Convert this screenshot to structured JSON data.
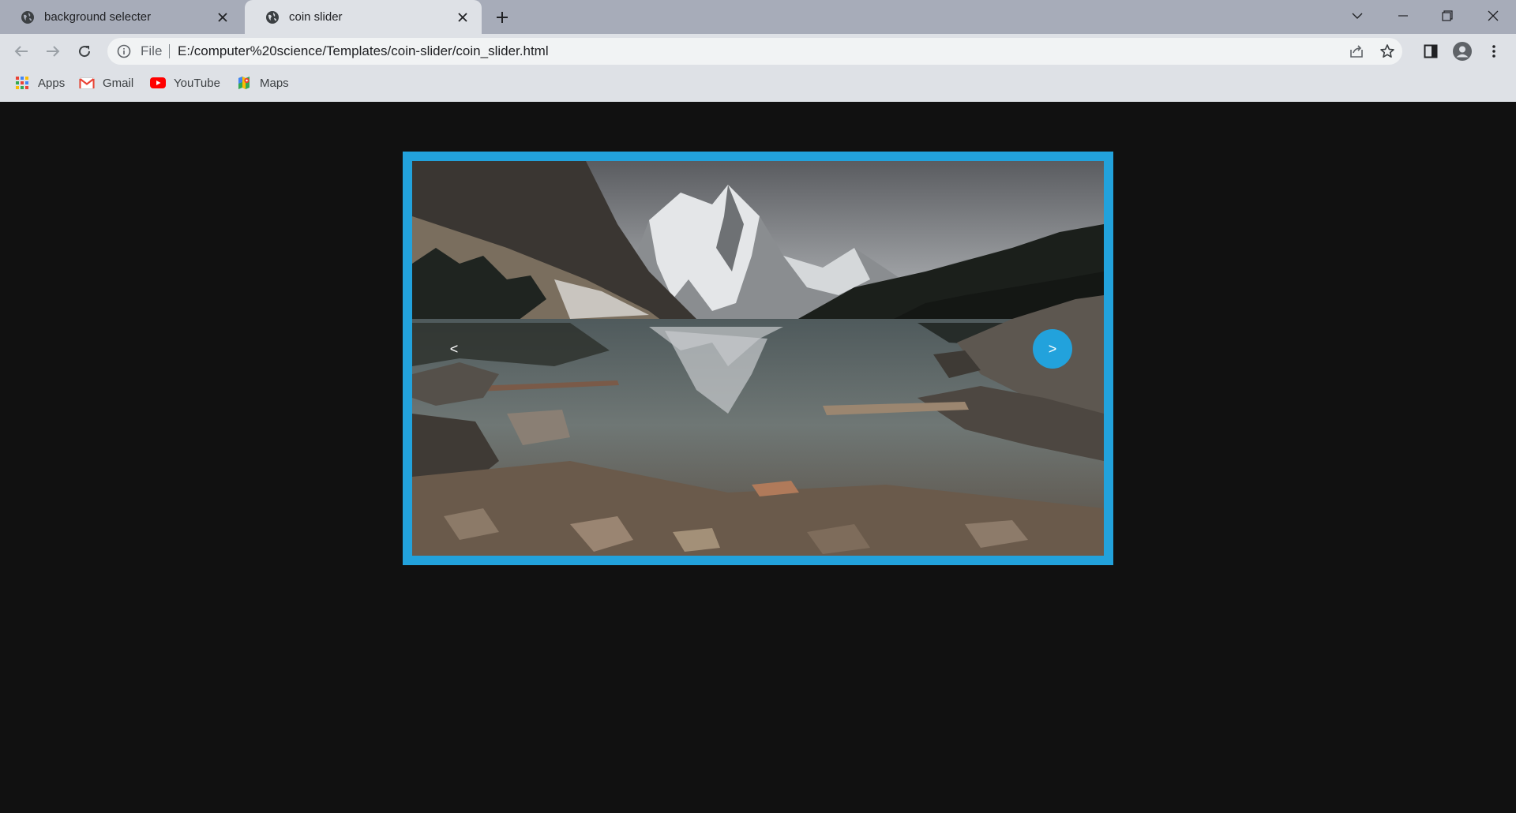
{
  "browser": {
    "tabs": [
      {
        "title": "background selecter",
        "active": false
      },
      {
        "title": "coin slider",
        "active": true
      }
    ],
    "address_scheme": "File",
    "address_url": "E:/computer%20science/Templates/coin-slider/coin_slider.html",
    "bookmarks": [
      {
        "label": "Apps",
        "icon": "apps-grid-icon"
      },
      {
        "label": "Gmail",
        "icon": "gmail-icon"
      },
      {
        "label": "YouTube",
        "icon": "youtube-icon"
      },
      {
        "label": "Maps",
        "icon": "maps-icon"
      }
    ]
  },
  "slider": {
    "prev_label": "<",
    "next_label": ">",
    "image_subject": "mountain lake reflection"
  },
  "colors": {
    "page_background": "#111111",
    "accent": "#22a2dc",
    "tabstrip": "#a7acb9",
    "toolbar": "#dee1e6"
  }
}
